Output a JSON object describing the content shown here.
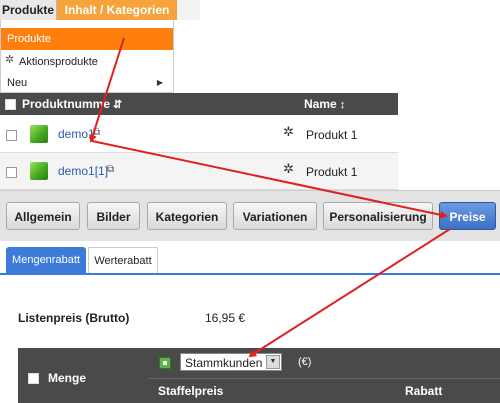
{
  "top_tabs": {
    "produkte": "Produkte",
    "inhalt": "Inhalt / Kategorien"
  },
  "menu": {
    "items": [
      "Produkte",
      "Aktionsprodukte",
      "Neu"
    ]
  },
  "grid": {
    "headers": {
      "number": "Produktnumme",
      "name": "Name"
    },
    "rows": [
      {
        "number": "demo1",
        "name": "Produkt 1"
      },
      {
        "number": "demo1[1]",
        "name": "Produkt 1"
      }
    ]
  },
  "buttons": [
    "Allgemein",
    "Bilder",
    "Kategorien",
    "Variationen",
    "Personalisierung",
    "Preise"
  ],
  "sub_tabs": [
    "Mengenrabatt",
    "Werterabatt"
  ],
  "list_price": {
    "label": "Listenpreis (Brutto)",
    "value": "16,95 €"
  },
  "price_grid": {
    "menge": "Menge",
    "customer_group": "Stammkunden",
    "unit": "(€)",
    "staffelpreis": "Staffelpreis",
    "rabatt": "Rabatt"
  },
  "colors": {
    "accent_orange": "#ff7f0e",
    "active_blue": "#3d7bd9",
    "arrow_red": "#e02020"
  }
}
